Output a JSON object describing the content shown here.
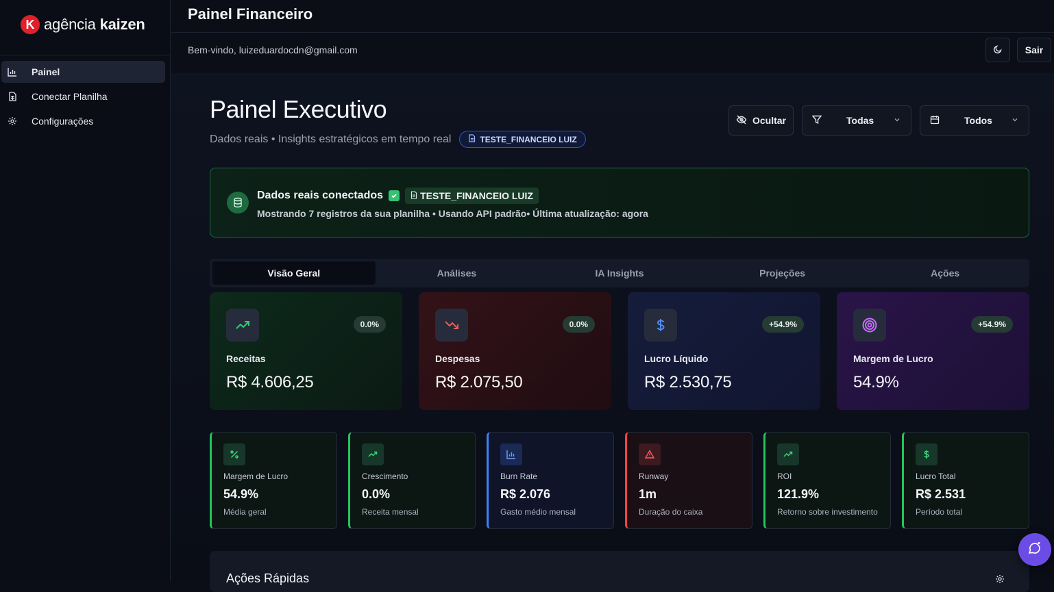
{
  "brand": {
    "mark": "K",
    "name_light": "agência ",
    "name_bold": "kaizen"
  },
  "sidebar": {
    "items": [
      {
        "label": "Painel",
        "icon": "bar-chart-icon",
        "active": true
      },
      {
        "label": "Conectar Planilha",
        "icon": "sheet-icon",
        "active": false
      },
      {
        "label": "Configurações",
        "icon": "gear-icon",
        "active": false
      }
    ]
  },
  "header": {
    "title": "Painel Financeiro",
    "welcome": "Bem-vindo, luizeduardocdn@gmail.com",
    "logout_label": "Sair",
    "theme_icon": "moon-icon"
  },
  "main": {
    "title": "Painel Executivo",
    "subtitle": "Dados reais • Insights estratégicos em tempo real",
    "sheet_pill": "TESTE_FINANCEIO LUIZ",
    "hide_label": "Ocultar",
    "filter_category": "Todas",
    "filter_period": "Todos"
  },
  "connection": {
    "title": "Dados reais conectados",
    "tag": "TESTE_FINANCEIO LUIZ",
    "text": "Mostrando 7 registros da sua planilha • Usando API padrão• Última atualização: agora"
  },
  "tabs": [
    "Visão Geral",
    "Análises",
    "IA Insights",
    "Projeções",
    "Ações"
  ],
  "kpis": [
    {
      "label": "Receitas",
      "value": "R$ 4.606,25",
      "badge": "0.0%",
      "icon": "trending-up-icon",
      "accent": "#2fcf6e"
    },
    {
      "label": "Despesas",
      "value": "R$ 2.075,50",
      "badge": "0.0%",
      "icon": "trending-down-icon",
      "accent": "#f05a5a"
    },
    {
      "label": "Lucro Líquido",
      "value": "R$ 2.530,75",
      "badge": "+54.9%",
      "icon": "dollar-icon",
      "accent": "#4f8cff"
    },
    {
      "label": "Margem de Lucro",
      "value": "54.9%",
      "badge": "+54.9%",
      "icon": "target-icon",
      "accent": "#b35cff"
    }
  ],
  "metrics": [
    {
      "label": "Margem de Lucro",
      "value": "54.9%",
      "sub": "Média geral",
      "icon": "percent-icon",
      "accent": "#22c55e"
    },
    {
      "label": "Crescimento",
      "value": "0.0%",
      "sub": "Receita mensal",
      "icon": "trending-up-icon",
      "accent": "#22c55e"
    },
    {
      "label": "Burn Rate",
      "value": "R$ 2.076",
      "sub": "Gasto médio mensal",
      "icon": "bar-chart-icon",
      "accent": "#3b82f6"
    },
    {
      "label": "Runway",
      "value": "1m",
      "sub": "Duração do caixa",
      "icon": "warning-icon",
      "accent": "#ef4444"
    },
    {
      "label": "ROI",
      "value": "121.9%",
      "sub": "Retorno sobre investimento",
      "icon": "trending-up-icon",
      "accent": "#22c55e"
    },
    {
      "label": "Lucro Total",
      "value": "R$ 2.531",
      "sub": "Período total",
      "icon": "dollar-icon",
      "accent": "#22c55e"
    }
  ],
  "quick_actions": {
    "title": "Ações Rápidas"
  }
}
